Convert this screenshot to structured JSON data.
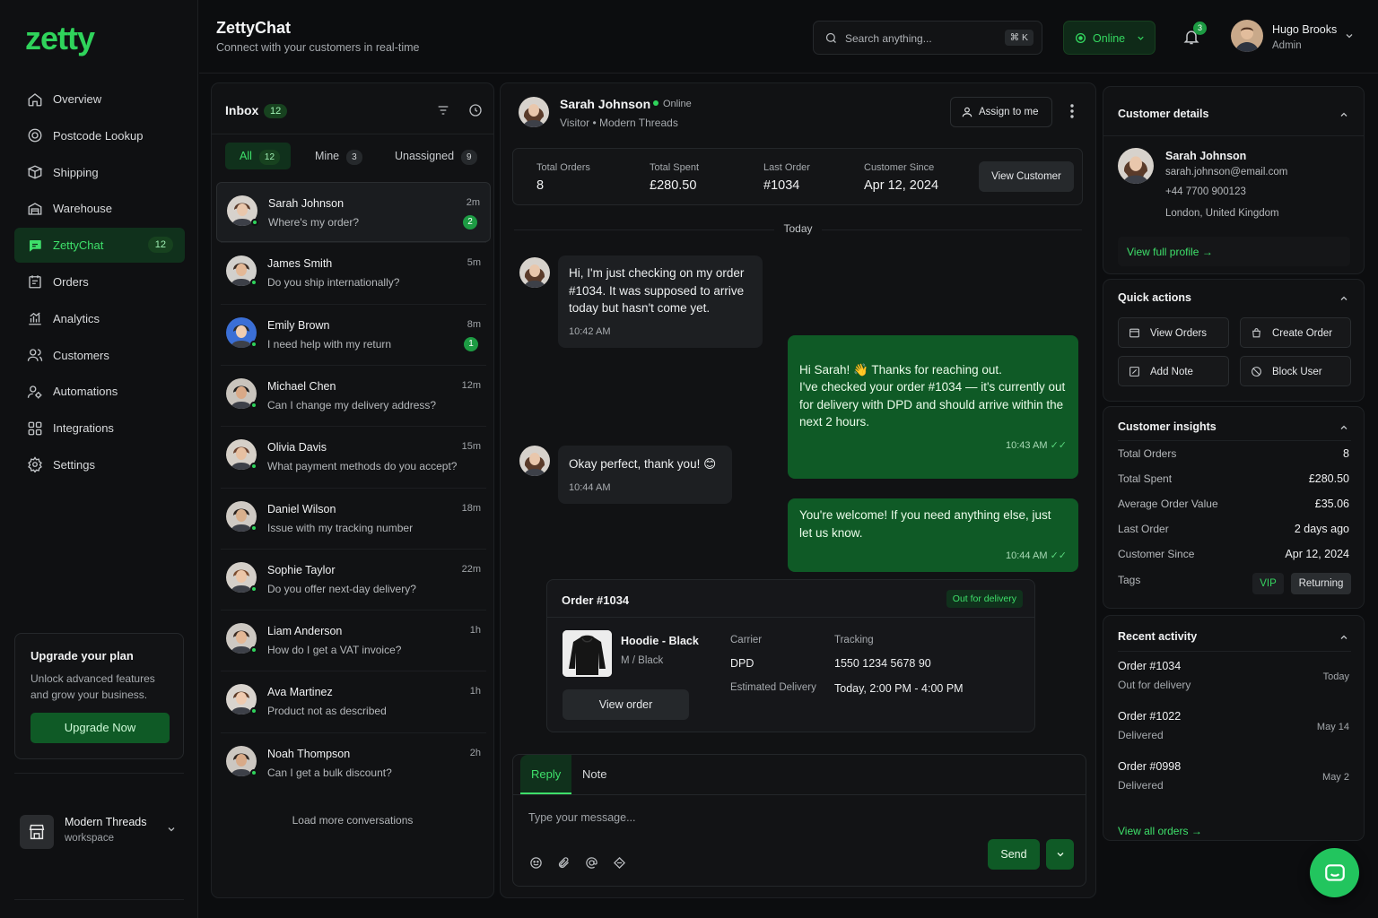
{
  "brand": {
    "logo": "zetty",
    "accent": "#2fd35b"
  },
  "sidebar": {
    "items": [
      {
        "label": "Overview",
        "icon": "home-icon"
      },
      {
        "label": "Postcode Lookup",
        "icon": "target-icon"
      },
      {
        "label": "Shipping",
        "icon": "box-icon"
      },
      {
        "label": "Warehouse",
        "icon": "warehouse-icon"
      },
      {
        "label": "ZettyChat",
        "icon": "chat-icon",
        "badge": "12",
        "active": true
      },
      {
        "label": "Orders",
        "icon": "orders-icon"
      },
      {
        "label": "Analytics",
        "icon": "analytics-icon"
      },
      {
        "label": "Customers",
        "icon": "users-icon"
      },
      {
        "label": "Automations",
        "icon": "automations-icon"
      },
      {
        "label": "Integrations",
        "icon": "grid-icon"
      },
      {
        "label": "Settings",
        "icon": "gear-icon"
      }
    ],
    "upgrade": {
      "title": "Upgrade your plan",
      "text": "Unlock advanced features and grow your business.",
      "button": "Upgrade Now"
    },
    "workspace": {
      "name": "Modern Threads",
      "sub": "workspace"
    }
  },
  "header": {
    "title": "ZettyChat",
    "subtitle": "Connect with your customers in real-time",
    "search_placeholder": "Search anything...",
    "shortcut": "⌘ K",
    "status": "Online",
    "notifications": "3",
    "user": {
      "name": "Hugo Brooks",
      "role": "Admin"
    }
  },
  "inbox": {
    "title": "Inbox",
    "count": "12",
    "tabs": [
      {
        "label": "All",
        "count": "12"
      },
      {
        "label": "Mine",
        "count": "3"
      },
      {
        "label": "Unassigned",
        "count": "9"
      }
    ],
    "conversations": [
      {
        "name": "Sarah Johnson",
        "preview": "Where's my order?",
        "time": "2m",
        "unread": "2"
      },
      {
        "name": "James Smith",
        "preview": "Do you ship internationally?",
        "time": "5m",
        "unread": ""
      },
      {
        "name": "Emily Brown",
        "preview": "I need help with my return",
        "time": "8m",
        "unread": "1"
      },
      {
        "name": "Michael Chen",
        "preview": "Can I change my delivery address?",
        "time": "12m",
        "unread": ""
      },
      {
        "name": "Olivia Davis",
        "preview": "What payment methods do you accept?",
        "time": "15m",
        "unread": ""
      },
      {
        "name": "Daniel Wilson",
        "preview": "Issue with my tracking number",
        "time": "18m",
        "unread": ""
      },
      {
        "name": "Sophie Taylor",
        "preview": "Do you offer next-day delivery?",
        "time": "22m",
        "unread": ""
      },
      {
        "name": "Liam Anderson",
        "preview": "How do I get a VAT invoice?",
        "time": "1h",
        "unread": ""
      },
      {
        "name": "Ava Martinez",
        "preview": "Product not as described",
        "time": "1h",
        "unread": ""
      },
      {
        "name": "Noah Thompson",
        "preview": "Can I get a bulk discount?",
        "time": "2h",
        "unread": ""
      }
    ],
    "load_more": "Load more conversations"
  },
  "chat": {
    "contact": {
      "name": "Sarah Johnson",
      "status": "Online",
      "sub": "Visitor • Modern Threads"
    },
    "assign": "Assign to me",
    "stats": [
      {
        "label": "Total Orders",
        "value": "8"
      },
      {
        "label": "Total Spent",
        "value": "£280.50"
      },
      {
        "label": "Last Order",
        "value": "#1034"
      },
      {
        "label": "Customer Since",
        "value": "Apr 12, 2024"
      }
    ],
    "view_customer": "View Customer",
    "day": "Today",
    "messages": [
      {
        "dir": "in",
        "text": "Hi, I'm just checking on my order #1034. It was supposed to arrive today but hasn't come yet.",
        "time": "10:42 AM"
      },
      {
        "dir": "out",
        "text": "Hi Sarah! 👋 Thanks for reaching out.\nI've checked your order #1034 — it's currently out for delivery with DPD and should arrive within the next 2 hours.",
        "time": "10:43 AM"
      },
      {
        "dir": "in",
        "text": "Okay perfect, thank you! 😊",
        "time": "10:44 AM"
      },
      {
        "dir": "out",
        "text": "You're welcome! If you need anything else, just let us know.",
        "time": "10:44 AM"
      }
    ],
    "order": {
      "title": "Order #1034",
      "status": "Out for delivery",
      "product": "Hoodie - Black",
      "variant": "M / Black",
      "carrier_label": "Carrier",
      "carrier": "DPD",
      "tracking_label": "Tracking",
      "tracking": "1550 1234 5678 90",
      "eta_label": "Estimated Delivery",
      "eta": "Today, 2:00 PM - 4:00 PM",
      "button": "View order"
    },
    "composer": {
      "tabs": [
        "Reply",
        "Note"
      ],
      "placeholder": "Type your message...",
      "send": "Send"
    }
  },
  "details": {
    "title": "Customer details",
    "name": "Sarah Johnson",
    "email": "sarah.johnson@email.com",
    "phone": "+44 7700 900123",
    "location": "London, United Kingdom",
    "link": "View full profile"
  },
  "quick": {
    "title": "Quick actions",
    "actions": [
      {
        "label": "View Orders",
        "icon": "orders-icon"
      },
      {
        "label": "Create Order",
        "icon": "bag-icon"
      },
      {
        "label": "Add Note",
        "icon": "note-icon"
      },
      {
        "label": "Block User",
        "icon": "block-icon"
      }
    ]
  },
  "insights": {
    "title": "Customer insights",
    "rows": [
      {
        "label": "Total Orders",
        "value": "8"
      },
      {
        "label": "Total Spent",
        "value": "£280.50"
      },
      {
        "label": "Average Order Value",
        "value": "£35.06"
      },
      {
        "label": "Last Order",
        "value": "2 days ago"
      },
      {
        "label": "Customer Since",
        "value": "Apr 12, 2024"
      }
    ],
    "tags_label": "Tags",
    "tags": [
      "VIP",
      "Returning"
    ]
  },
  "activity": {
    "title": "Recent activity",
    "items": [
      {
        "title": "Order #1034",
        "status": "Out for delivery",
        "date": "Today"
      },
      {
        "title": "Order #1022",
        "status": "Delivered",
        "date": "May 14"
      },
      {
        "title": "Order #0998",
        "status": "Delivered",
        "date": "May 2"
      }
    ],
    "link": "View all orders"
  }
}
